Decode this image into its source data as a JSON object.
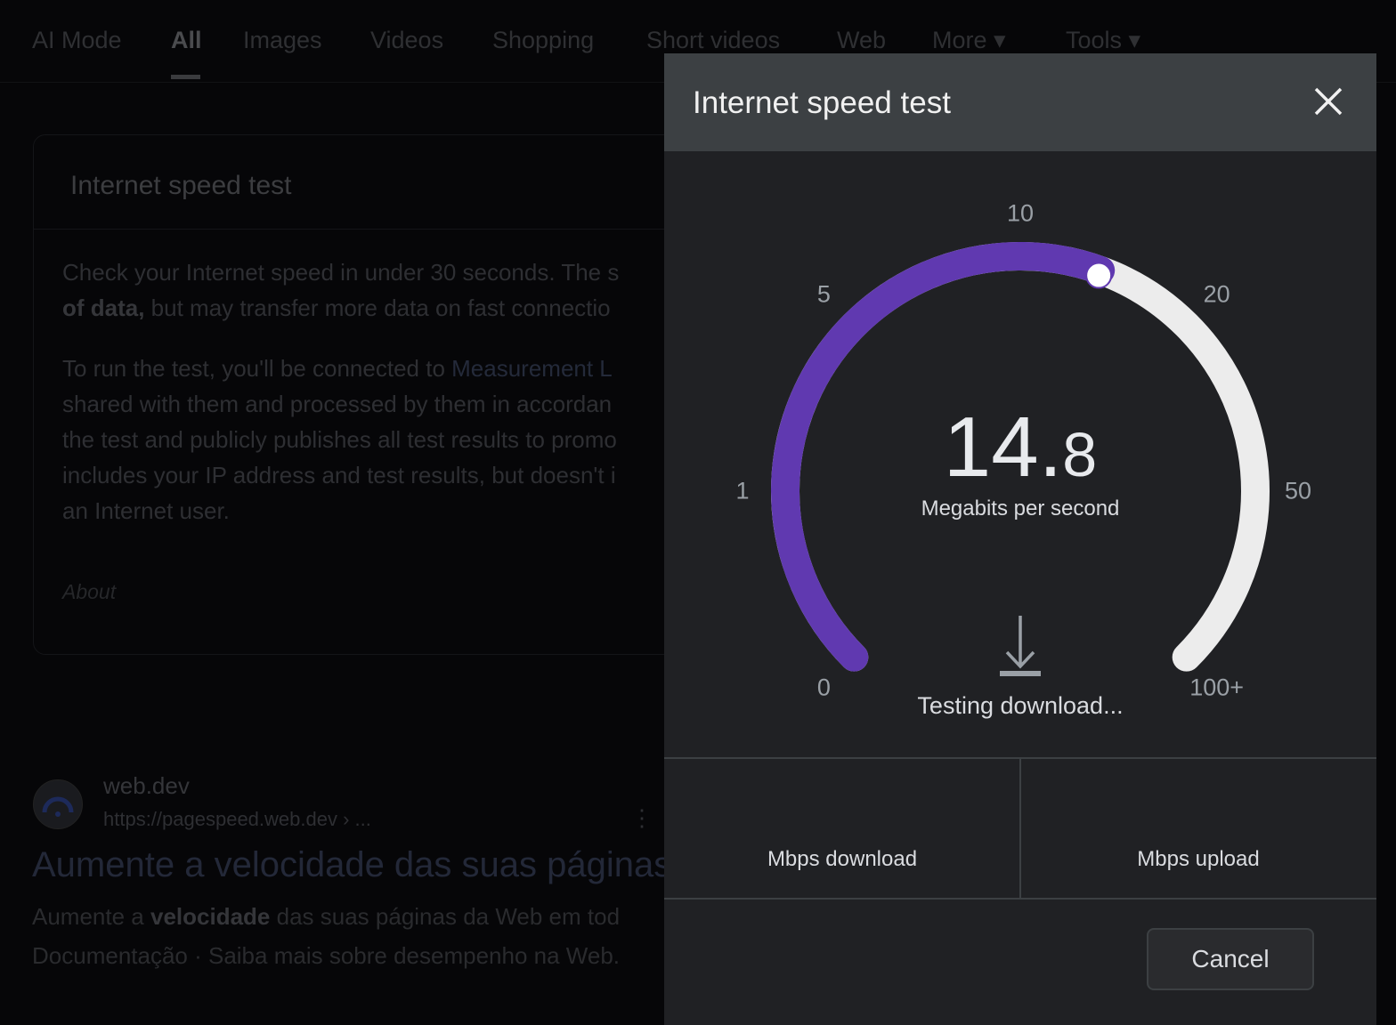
{
  "tabs": [
    {
      "label": "AI Mode"
    },
    {
      "label": "All",
      "active": true
    },
    {
      "label": "Images"
    },
    {
      "label": "Videos"
    },
    {
      "label": "Shopping"
    },
    {
      "label": "Short videos"
    },
    {
      "label": "Web"
    },
    {
      "label": "More ▾"
    },
    {
      "label": "Tools ▾"
    }
  ],
  "card": {
    "title": "Internet speed test",
    "p1_line1": "Check your Internet speed in under 30 seconds. The s",
    "p1_bold": "of data,",
    "p1_line2": " but may transfer more data on fast connectio",
    "p2_line1_a": "To run the test, you'll be connected to ",
    "p2_link": "Measurement L",
    "p2_line2": "shared with them and processed by them in accordan",
    "p2_line3": "the test and publicly publishes all test results to promo",
    "p2_line4": "includes your IP address and test results, but doesn't i",
    "p2_line5": "an Internet user.",
    "about": "About"
  },
  "result": {
    "site": "web.dev",
    "url": "https://pagespeed.web.dev › ...",
    "title": "Aumente a velocidade das suas páginas",
    "snippet1_a": "Aumente a ",
    "snippet1_bold": "velocidade",
    "snippet1_b": " das suas páginas da Web em tod",
    "snippet2": "Documentação · Saiba mais sobre desempenho na Web."
  },
  "dialog": {
    "title": "Internet speed test",
    "speed_int": "14.",
    "speed_dec": "8",
    "unit": "Megabits per second",
    "status": "Testing download...",
    "download_label": "Mbps download",
    "upload_label": "Mbps upload",
    "cancel_label": "Cancel",
    "gauge_ticks": [
      "0",
      "1",
      "5",
      "10",
      "20",
      "50",
      "100+"
    ],
    "gauge_progress": 0.574,
    "colors": {
      "progress": "#6039b0",
      "track": "#ececec",
      "knob": "#ffffff"
    }
  }
}
